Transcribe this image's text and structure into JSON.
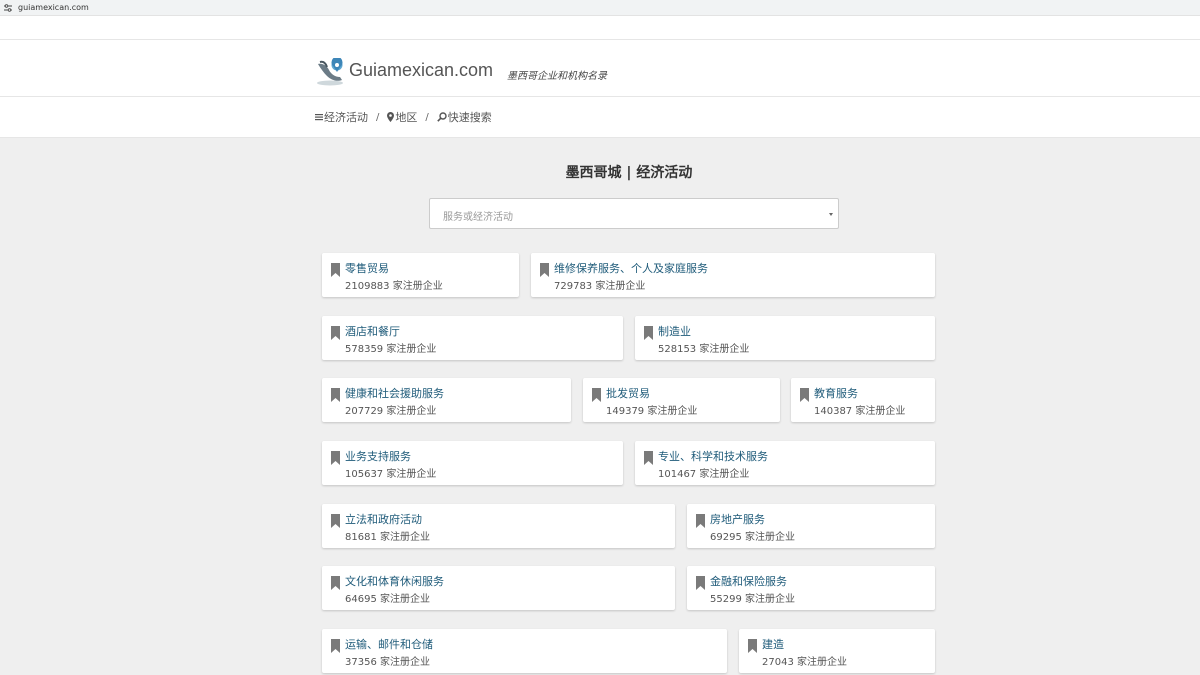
{
  "browser": {
    "url": "guiamexican.com"
  },
  "header": {
    "brand": "Guiamexican.com",
    "tagline": "墨西哥企业和机构名录"
  },
  "nav": {
    "activities": "经济活动",
    "region": "地区",
    "quick_search": "快速搜索",
    "separator": "/"
  },
  "main": {
    "title": "墨西哥城 | 经济活动",
    "search_placeholder": "服务或经济活动"
  },
  "categories": [
    {
      "name": "零售贸易",
      "count": "2109883 家注册企业"
    },
    {
      "name": "维修保养服务、个人及家庭服务",
      "count": "729783 家注册企业"
    },
    {
      "name": "酒店和餐厅",
      "count": "578359 家注册企业"
    },
    {
      "name": "制造业",
      "count": "528153 家注册企业"
    },
    {
      "name": "健康和社会援助服务",
      "count": "207729 家注册企业"
    },
    {
      "name": "批发贸易",
      "count": "149379 家注册企业"
    },
    {
      "name": "教育服务",
      "count": "140387 家注册企业"
    },
    {
      "name": "业务支持服务",
      "count": "105637 家注册企业"
    },
    {
      "name": "专业、科学和技术服务",
      "count": "101467 家注册企业"
    },
    {
      "name": "立法和政府活动",
      "count": "81681 家注册企业"
    },
    {
      "name": "房地产服务",
      "count": "69295 家注册企业"
    },
    {
      "name": "文化和体育休闲服务",
      "count": "64695 家注册企业"
    },
    {
      "name": "金融和保险服务",
      "count": "55299 家注册企业"
    },
    {
      "name": "运输、邮件和仓储",
      "count": "37356 家注册企业"
    },
    {
      "name": "建造",
      "count": "27043 家注册企业"
    }
  ],
  "colors": {
    "link": "#1f5b7a",
    "background": "#efefef",
    "bookmark": "#7a7a7a"
  }
}
